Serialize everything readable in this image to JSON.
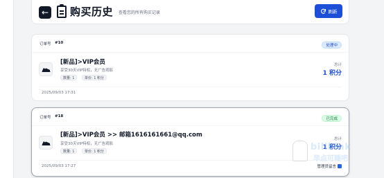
{
  "header": {
    "title": "购买历史",
    "subtitle": "查看您的所有购买记录",
    "refresh_label": "刷新",
    "back_icon": "arrow-left-icon",
    "title_icon": "clipboard-icon",
    "refresh_icon": "refresh-icon"
  },
  "orders": [
    {
      "order_label": "订单号",
      "order_no": "#10",
      "status": "处理中",
      "product_name": "[新品]>VIP会员",
      "description": "享受30天VIP特权，无广告观影",
      "quantity": "数量: 1",
      "unit_price": "单价: 1 积分",
      "total_label": "总计",
      "total": "1 积分",
      "time": "2025/09/03 17:31"
    },
    {
      "order_label": "订单号",
      "order_no": "#18",
      "status": "已完成",
      "product_name": "[新品]>VIP会员 >> 邮箱1616161661@qq.com",
      "description": "享受30天VIP特权，无广告观影",
      "quantity": "数量: 1",
      "unit_price": "单价: 1 积分",
      "total_label": "总计",
      "total": "1 积分",
      "time": "2025/09/03 17:27",
      "manage_label": "管理员留言"
    }
  ],
  "watermark": {
    "line1": "bilibink",
    "line2": "早点可睡吧"
  },
  "colors": {
    "accent": "#1d4ed8",
    "processing_bg": "#dbeafe",
    "done_bg": "#dcfce7",
    "done_text": "#15803d"
  }
}
